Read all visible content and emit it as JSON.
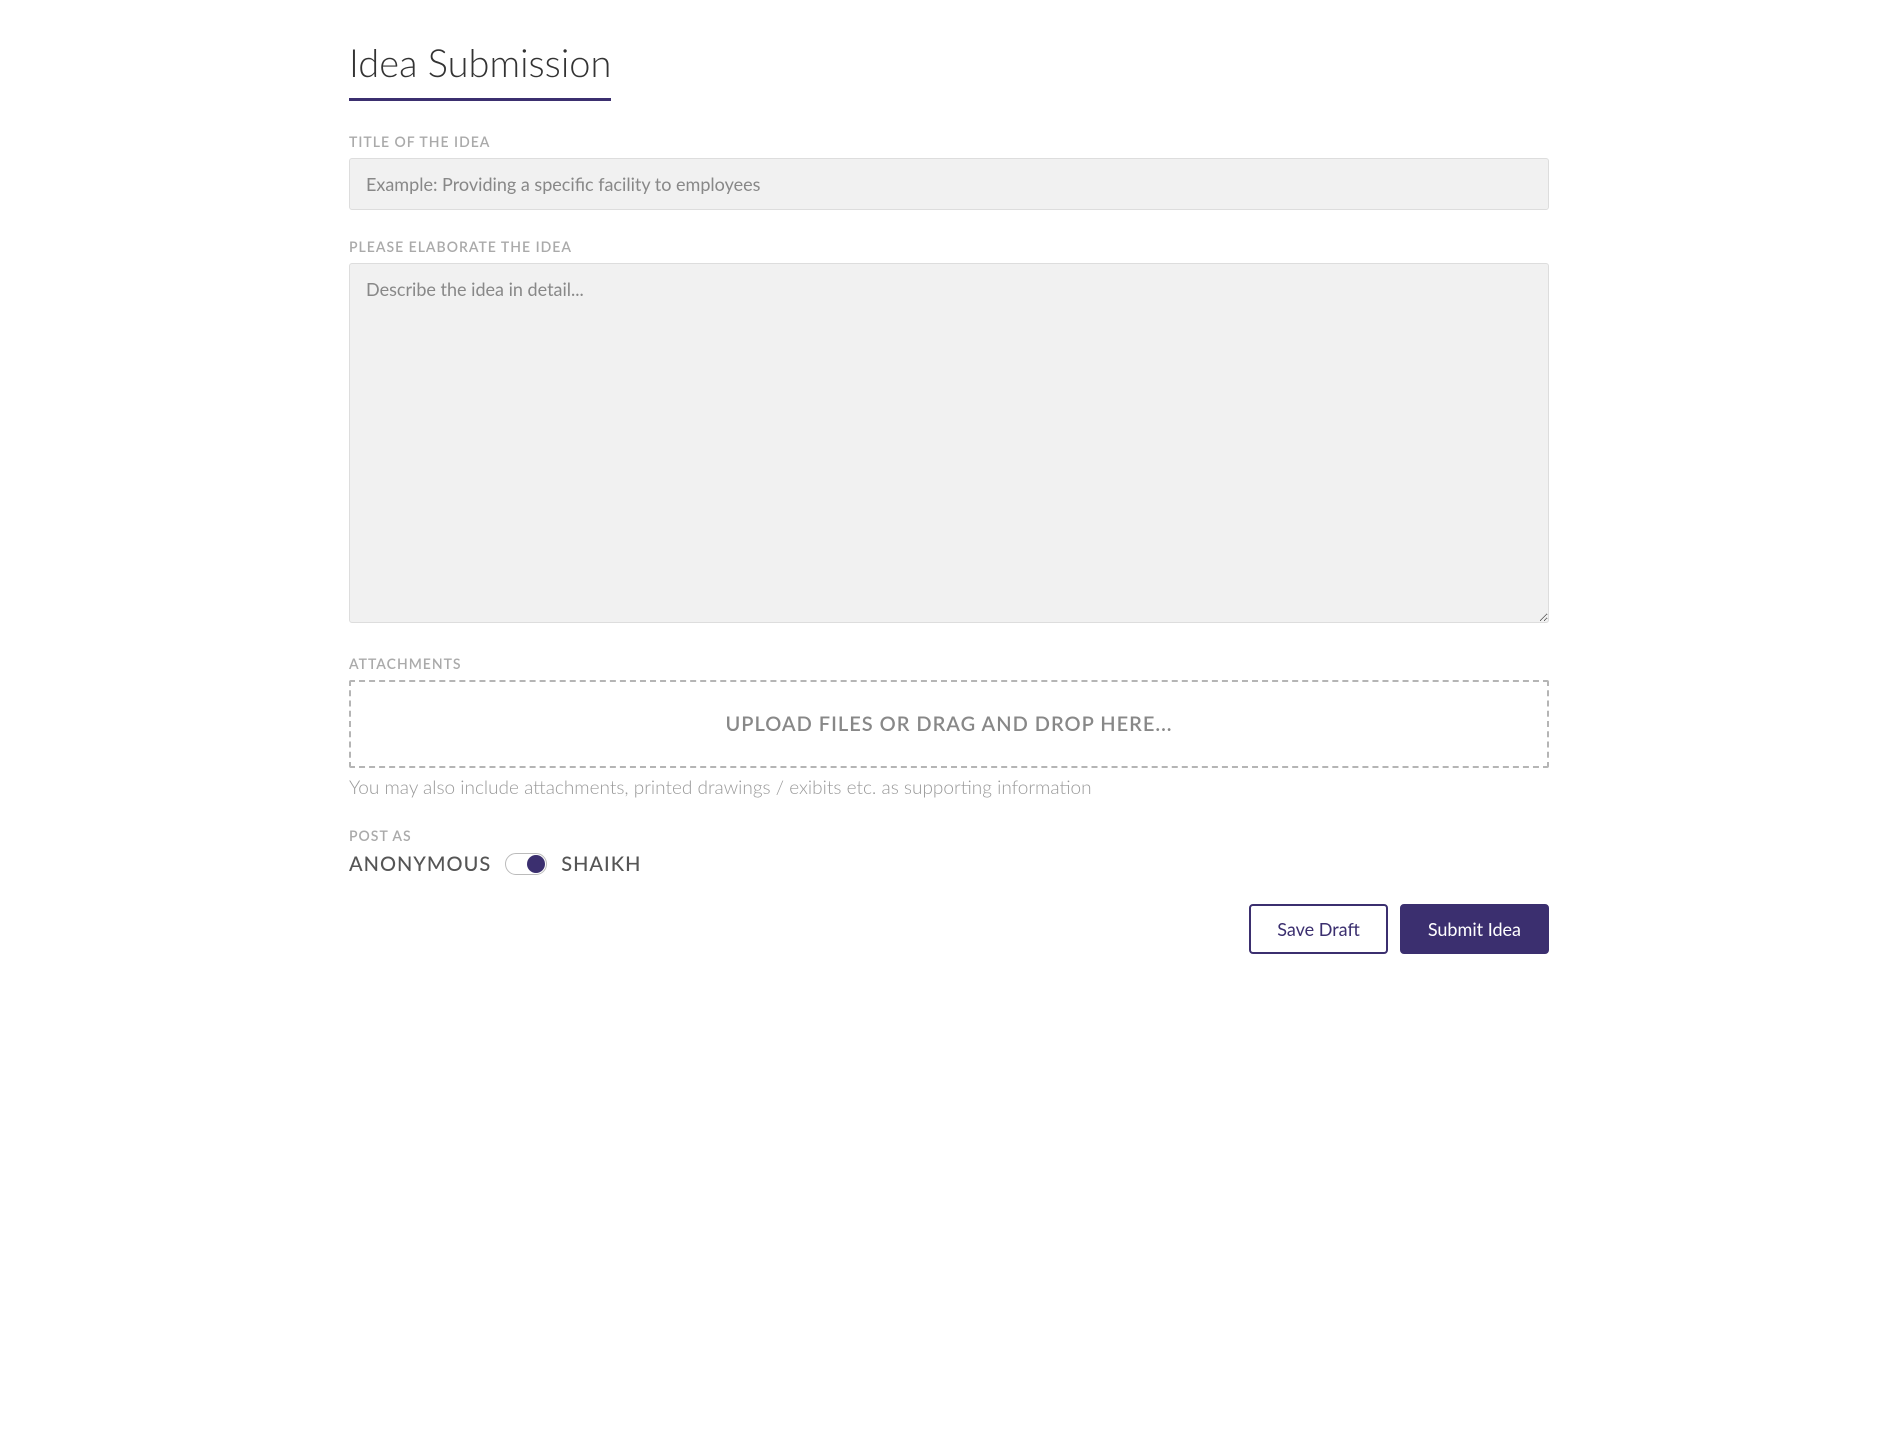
{
  "page": {
    "title": "Idea Submission"
  },
  "form": {
    "title_field": {
      "label": "TITLE OF THE IDEA",
      "placeholder": "Example: Providing a specific facility to employees",
      "value": ""
    },
    "elaborate_field": {
      "label": "PLEASE ELABORATE THE IDEA",
      "placeholder": "Describe the idea in detail...",
      "value": ""
    },
    "attachments": {
      "label": "ATTACHMENTS",
      "dropzone_text": "UPLOAD FILES OR DRAG AND DROP HERE...",
      "helper": "You may also include attachments, printed drawings / exibits etc. as supporting information"
    },
    "post_as": {
      "label": "POST AS",
      "option_left": "ANONYMOUS",
      "option_right": "SHAIKH",
      "toggle_on_right": true
    }
  },
  "buttons": {
    "save_draft": "Save Draft",
    "submit": "Submit Idea"
  },
  "colors": {
    "accent": "#3b2f6f"
  }
}
